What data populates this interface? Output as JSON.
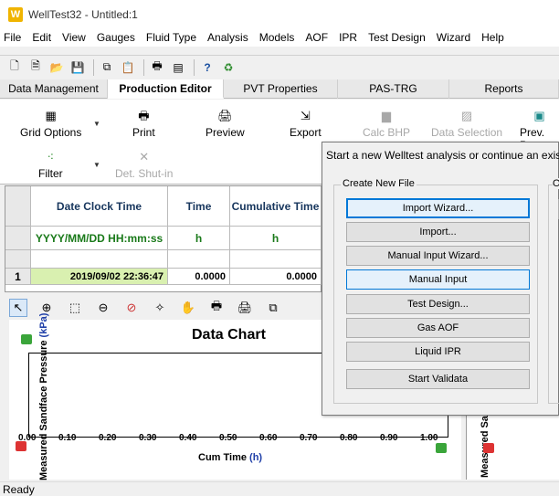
{
  "window": {
    "title": "WellTest32 - Untitled:1",
    "icon": "W"
  },
  "menu": [
    "File",
    "Edit",
    "View",
    "Gauges",
    "Fluid Type",
    "Analysis",
    "Models",
    "AOF",
    "IPR",
    "Test Design",
    "Wizard",
    "Help"
  ],
  "tabs": [
    {
      "label": "Data Management",
      "active": false
    },
    {
      "label": "Production Editor",
      "active": true
    },
    {
      "label": "PVT Properties",
      "active": false
    },
    {
      "label": "PAS-TRG",
      "active": false
    },
    {
      "label": "Reports",
      "active": false
    }
  ],
  "ribbon": {
    "grid_options": "Grid Options",
    "print": "Print",
    "preview": "Preview",
    "export": "Export",
    "calc_bhp": "Calc BHP",
    "data_selection": "Data Selection",
    "prev_pro": "Prev. Pro",
    "filter": "Filter",
    "det_shutin": "Det. Shut-in"
  },
  "grid": {
    "headers": [
      "Date Clock Time",
      "Time",
      "Cumulative Time"
    ],
    "units": [
      "YYYY/MM/DD HH:mm:ss",
      "h",
      "h"
    ],
    "rows": [
      {
        "num": "1",
        "date": "2019/09/02 22:36:47",
        "time": "0.0000",
        "cum": "0.0000"
      }
    ]
  },
  "chart_data": {
    "type": "scatter",
    "title": "Data Chart",
    "xlabel": "Cum Time",
    "xlabel_unit": "(h)",
    "ylabel": "Measured Sandface Pressure",
    "ylabel_unit": "(kPa)",
    "x_ticks": [
      "0.00",
      "0.10",
      "0.20",
      "0.30",
      "0.40",
      "0.50",
      "0.60",
      "0.70",
      "0.80",
      "0.90",
      "1.00"
    ],
    "xlim": [
      0,
      1
    ],
    "series": []
  },
  "chart2": {
    "ylabel": "Measured Sa"
  },
  "dialog": {
    "message": "Start a new Welltest analysis or continue an existi",
    "group_label": "Create New File",
    "group2_label": "O",
    "buttons": [
      "Import Wizard...",
      "Import...",
      "Manual Input Wizard...",
      "Manual Input",
      "Test Design...",
      "Gas AOF",
      "Liquid IPR",
      "Start Validata"
    ]
  },
  "status": "Ready"
}
